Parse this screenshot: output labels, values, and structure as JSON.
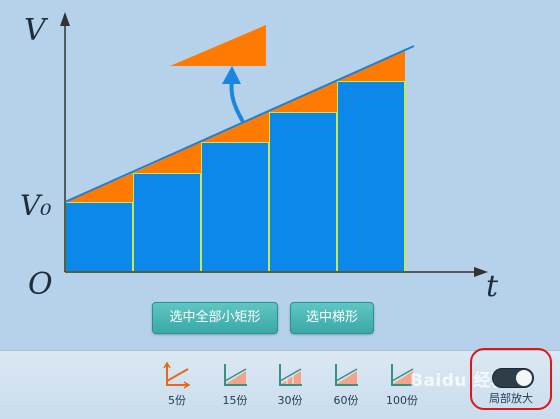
{
  "diagram": {
    "axis_v": "V",
    "axis_v0": "V₀",
    "axis_origin": "O",
    "axis_t": "t",
    "colors": {
      "rect_fill": "#0b88ea",
      "rect_border": "#c9e84b",
      "triangle_fill": "#ff7a00",
      "line": "#1f7fd6",
      "axis": "#333333",
      "arrow": "#1b85e0"
    }
  },
  "buttons": {
    "select_rects": "选中全部小矩形",
    "select_trapezoid": "选中梯形"
  },
  "segments": [
    {
      "label": "5份",
      "icon": "split-5-icon"
    },
    {
      "label": "15份",
      "icon": "split-15-icon"
    },
    {
      "label": "30份",
      "icon": "split-30-icon"
    },
    {
      "label": "60份",
      "icon": "split-60-icon"
    },
    {
      "label": "100份",
      "icon": "split-100-icon"
    }
  ],
  "toggle": {
    "label": "局部放大",
    "state": "on"
  },
  "watermark": "Baidu 经验"
}
